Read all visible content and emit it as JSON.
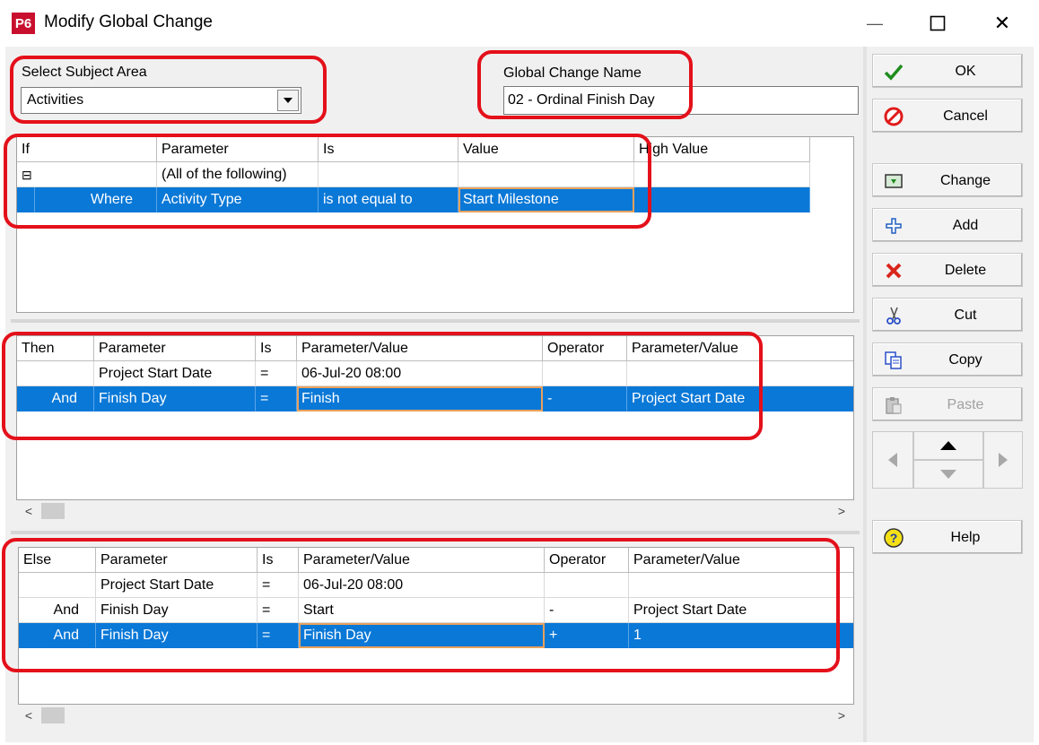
{
  "window": {
    "icon_text": "P6",
    "title": "Modify Global Change",
    "minimize_glyph": "—",
    "maximize_glyph": "☐",
    "close_glyph": "✕"
  },
  "subject": {
    "label": "Select Subject Area",
    "value": "Activities"
  },
  "gc_name": {
    "label": "Global Change Name",
    "value": "02 - Ordinal Finish Day"
  },
  "if_grid": {
    "headers": [
      "If",
      "Parameter",
      "Is",
      "Value",
      "High Value"
    ],
    "rows": [
      {
        "c0": "⊟",
        "c1": "(All of the following)",
        "c2": "",
        "c3": "",
        "c4": ""
      },
      {
        "c0": "Where",
        "c1": "Activity Type",
        "c2": "is not equal to",
        "c3": "Start Milestone",
        "c4": ""
      }
    ]
  },
  "then_grid": {
    "headers": [
      "Then",
      "Parameter",
      "Is",
      "Parameter/Value",
      "Operator",
      "Parameter/Value"
    ],
    "rows": [
      {
        "c0": "",
        "c1": "Project Start Date",
        "c2": "=",
        "c3": "06-Jul-20 08:00",
        "c4": "",
        "c5": ""
      },
      {
        "c0": "And",
        "c1": "Finish Day",
        "c2": "=",
        "c3": "Finish",
        "c4": "-",
        "c5": "Project Start Date"
      }
    ]
  },
  "else_grid": {
    "headers": [
      "Else",
      "Parameter",
      "Is",
      "Parameter/Value",
      "Operator",
      "Parameter/Value"
    ],
    "rows": [
      {
        "c0": "",
        "c1": "Project Start Date",
        "c2": "=",
        "c3": "06-Jul-20 08:00",
        "c4": "",
        "c5": ""
      },
      {
        "c0": "And",
        "c1": "Finish Day",
        "c2": "=",
        "c3": "Start",
        "c4": "-",
        "c5": "Project Start Date"
      },
      {
        "c0": "And",
        "c1": "Finish Day",
        "c2": "=",
        "c3": "Finish Day",
        "c4": "+",
        "c5": "1"
      }
    ]
  },
  "scroll": {
    "left": "<",
    "right": ">"
  },
  "buttons": {
    "ok": "OK",
    "cancel": "Cancel",
    "change": "Change",
    "add": "Add",
    "delete": "Delete",
    "cut": "Cut",
    "copy": "Copy",
    "paste": "Paste",
    "help": "Help"
  },
  "colors": {
    "selection": "#0a78d7",
    "annotation": "#e4101a",
    "app_icon": "#c8102e"
  }
}
